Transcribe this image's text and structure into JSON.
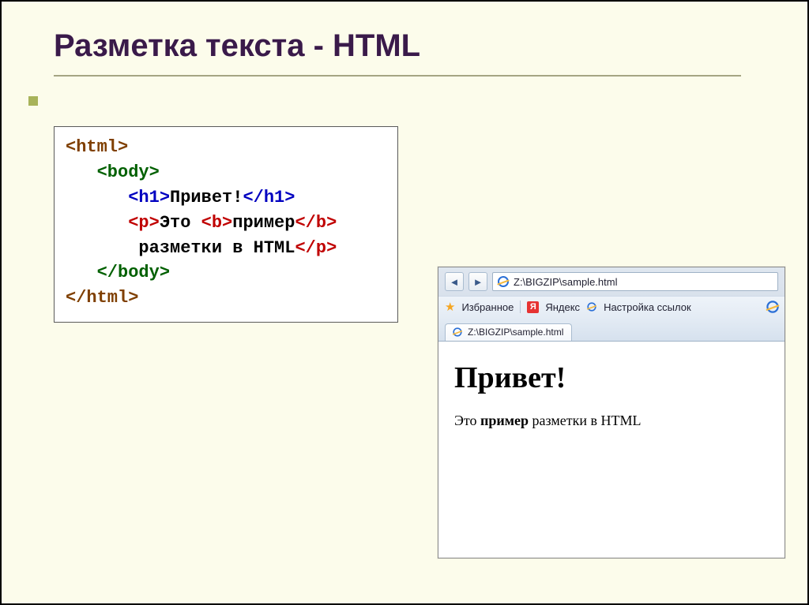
{
  "title": "Разметка текста - HTML",
  "code": {
    "html_open": "<html>",
    "body_open": "<body>",
    "h1_open": "<h1>",
    "h1_text": "Привет!",
    "h1_close": "</h1>",
    "p_open": "<p>",
    "p_text1": "Это ",
    "b_open": "<b>",
    "b_text": "пример",
    "b_close": "</b>",
    "line4_indent": "       ",
    "p_text2": "разметки в HTML",
    "p_close": "</p>",
    "body_close": "</body>",
    "html_close": "</html>",
    "indent1": "   ",
    "indent2": "      "
  },
  "browser": {
    "url": "Z:\\BIGZIP\\sample.html",
    "favorites_label": "Избранное",
    "yandex_label": "Яндекс",
    "yandex_glyph": "Я",
    "links_setup": "Настройка ссылок",
    "tab_title": "Z:\\BIGZIP\\sample.html",
    "nav_back": "◄",
    "nav_fwd": "►"
  },
  "rendered": {
    "heading": "Привет!",
    "p_before": "Это ",
    "p_bold": "пример",
    "p_after": " разметки в HTML"
  }
}
